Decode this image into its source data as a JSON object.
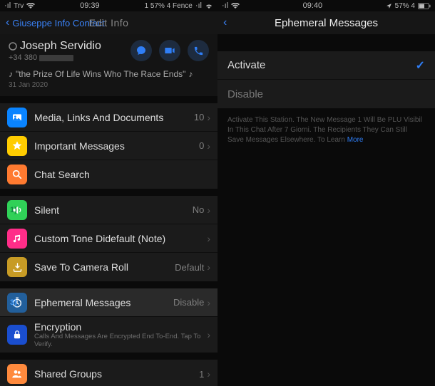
{
  "left": {
    "statusbar": {
      "carrier": "Trv",
      "time": "09:39",
      "right": "1 57% 4 Fence"
    },
    "nav": {
      "back": "Giuseppe Info Contact",
      "title": "Edit Info"
    },
    "contact": {
      "name": "Joseph Servidio",
      "phone_prefix": "+34 380",
      "status": "\"the Prize Of Life Wins Who The Race Ends\"",
      "date": "31 Jan 2020"
    },
    "group1": [
      {
        "label": "Media, Links And Documents",
        "value": "10"
      },
      {
        "label": "Important Messages",
        "value": "0"
      },
      {
        "label": "Chat Search",
        "value": ""
      }
    ],
    "group2": [
      {
        "label": "Silent",
        "value": "No"
      },
      {
        "label": "Custom Tone Didefault (Note)",
        "value": ""
      },
      {
        "label": "Save To Camera Roll",
        "value": "Default"
      }
    ],
    "group3": [
      {
        "label": "Ephemeral Messages",
        "value": "Disable"
      },
      {
        "label": "Encryption",
        "sub": "Calls And Messages Are Encrypted End To-End. Tap To Verify.",
        "value": ""
      }
    ],
    "group4": [
      {
        "label": "Shared Groups",
        "value": "1"
      }
    ]
  },
  "right": {
    "statusbar": {
      "carrier": "",
      "time": "09:40",
      "right": "57% 4"
    },
    "nav": {
      "title": "Ephemeral Messages"
    },
    "options": [
      {
        "label": "Activate",
        "checked": true
      },
      {
        "label": "Disable",
        "checked": false
      }
    ],
    "note": "Activate This Station. The New Message 1 Will Be PLU Visibil In This Chat After 7 Giorni. The Recipients They Can Still Save Messages Elsewhere. To Learn",
    "note_more": "More"
  }
}
